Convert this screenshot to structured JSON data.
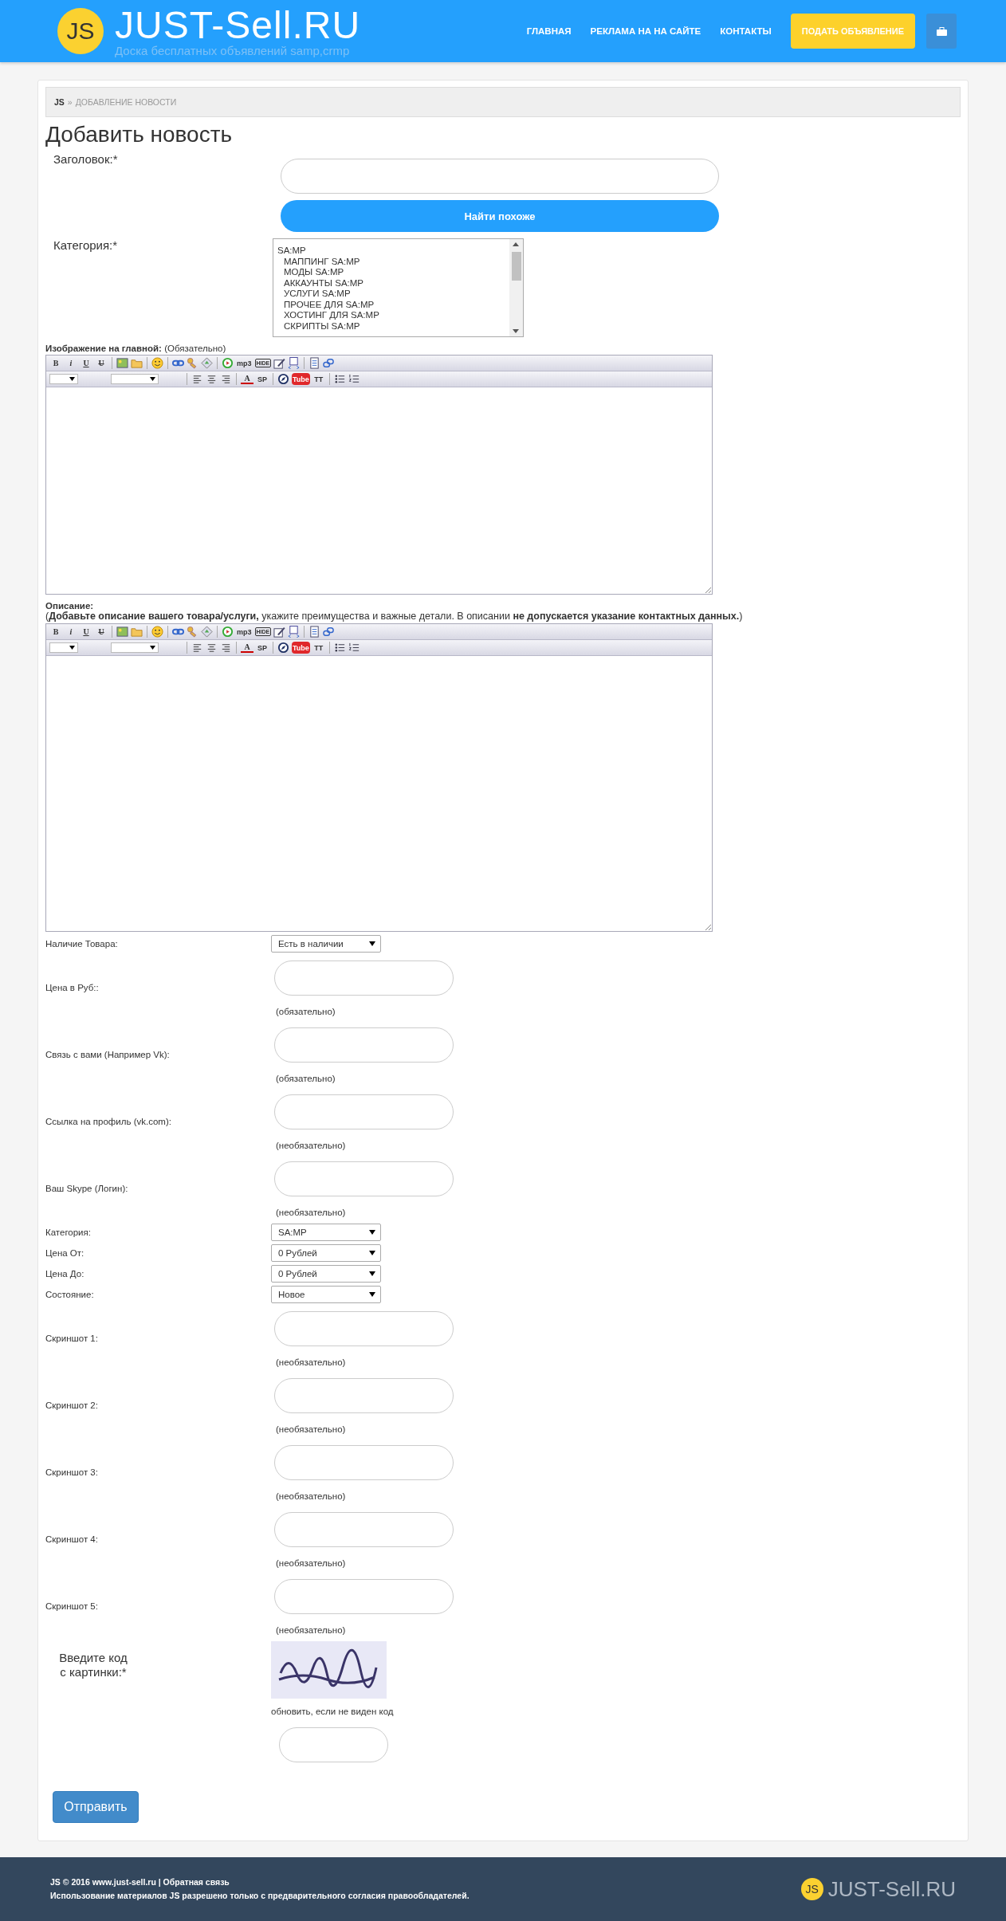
{
  "header": {
    "logo_badge": "JS",
    "brand": "JUST-Sell.RU",
    "tagline": "Доска бесплатных объявлений samp,crmp",
    "nav": [
      {
        "label": "ГЛАВНАЯ"
      },
      {
        "label": "РЕКЛАМА НА НА САЙТЕ"
      },
      {
        "label": "КОНТАКТЫ"
      }
    ],
    "cta": "ПОДАТЬ ОБЪЯВЛЕНИЕ"
  },
  "breadcrumb": {
    "home": "JS",
    "separator": "»",
    "current": "ДОБАВЛЕНИЕ НОВОСТИ"
  },
  "title": "Добавить новость",
  "headline_field": {
    "label": "Заголовок:*",
    "button": "Найти похоже"
  },
  "category_field": {
    "label": "Категория:*",
    "options": [
      {
        "label": "SA:MP",
        "children": [
          {
            "label": "МАППИНГ SA:MP"
          },
          {
            "label": "МОДЫ SA:MP"
          },
          {
            "label": "АККАУНТЫ SA:MP"
          },
          {
            "label": "УСЛУГИ SA:MP"
          },
          {
            "label": "ПРОЧЕЕ ДЛЯ SA:MP"
          },
          {
            "label": "ХОСТИНГ ДЛЯ SA:MP"
          },
          {
            "label": "СКРИПТЫ SA:MP"
          }
        ]
      }
    ]
  },
  "editors": [
    {
      "label": "**Изображение на главной:** (Обязательно)",
      "toolbar": [
        [
          {
            "kind": "bold",
            "label": "B"
          },
          {
            "kind": "italic",
            "label": "i"
          },
          {
            "kind": "underline",
            "label": "U"
          },
          {
            "kind": "strike",
            "label": "U"
          },
          {
            "kind": "sep"
          },
          {
            "kind": "image"
          },
          {
            "kind": "folder"
          },
          {
            "kind": "sep"
          },
          {
            "kind": "smiley"
          },
          {
            "kind": "sep"
          },
          {
            "kind": "link"
          },
          {
            "kind": "key"
          },
          {
            "kind": "paste"
          },
          {
            "kind": "sep"
          },
          {
            "kind": "play"
          },
          {
            "kind": "word",
            "label": "mp3"
          },
          {
            "kind": "tag",
            "label": "HIDE"
          },
          {
            "kind": "edit"
          },
          {
            "kind": "code"
          },
          {
            "kind": "sep"
          },
          {
            "kind": "page"
          },
          {
            "kind": "chain"
          }
        ],
        [
          {
            "kind": "select"
          },
          {
            "kind": "select"
          },
          {
            "kind": "sep"
          },
          {
            "kind": "align-left"
          },
          {
            "kind": "align-center"
          },
          {
            "kind": "align-right"
          },
          {
            "kind": "sep"
          },
          {
            "kind": "color",
            "label": "A"
          },
          {
            "kind": "word",
            "label": "SP"
          },
          {
            "kind": "sep"
          },
          {
            "kind": "compass"
          },
          {
            "kind": "video",
            "label": "Tube"
          },
          {
            "kind": "word",
            "label": "TT"
          },
          {
            "kind": "sep"
          },
          {
            "kind": "bullets"
          },
          {
            "kind": "numbers"
          }
        ]
      ]
    },
    {
      "label": "**Описание:**",
      "note": "(**Добавьте описание вашего товара/услуги,** укажите преимущества и важные детали. В описании **не допускается указание контактных данных.**)",
      "toolbar": [
        [
          {
            "kind": "bold",
            "label": "B"
          },
          {
            "kind": "italic",
            "label": "i"
          },
          {
            "kind": "underline",
            "label": "U"
          },
          {
            "kind": "strike",
            "label": "U"
          },
          {
            "kind": "sep"
          },
          {
            "kind": "image"
          },
          {
            "kind": "folder"
          },
          {
            "kind": "sep"
          },
          {
            "kind": "smiley"
          },
          {
            "kind": "sep"
          },
          {
            "kind": "link"
          },
          {
            "kind": "key"
          },
          {
            "kind": "paste"
          },
          {
            "kind": "sep"
          },
          {
            "kind": "play"
          },
          {
            "kind": "word",
            "label": "mp3"
          },
          {
            "kind": "tag",
            "label": "HIDE"
          },
          {
            "kind": "edit"
          },
          {
            "kind": "code"
          },
          {
            "kind": "sep"
          },
          {
            "kind": "page"
          },
          {
            "kind": "chain"
          }
        ],
        [
          {
            "kind": "select"
          },
          {
            "kind": "select"
          },
          {
            "kind": "sep"
          },
          {
            "kind": "align-left"
          },
          {
            "kind": "align-center"
          },
          {
            "kind": "align-right"
          },
          {
            "kind": "sep"
          },
          {
            "kind": "color",
            "label": "A"
          },
          {
            "kind": "word",
            "label": "SP"
          },
          {
            "kind": "sep"
          },
          {
            "kind": "compass"
          },
          {
            "kind": "video",
            "label": "Tube"
          },
          {
            "kind": "word",
            "label": "TT"
          },
          {
            "kind": "sep"
          },
          {
            "kind": "bullets"
          },
          {
            "kind": "numbers"
          }
        ]
      ]
    }
  ],
  "fields": [
    {
      "kind": "select",
      "label": "Наличие Товара:",
      "value": "Есть в наличии"
    },
    {
      "kind": "input",
      "label": "Цена в Руб::",
      "note": "(обязательно)"
    },
    {
      "kind": "input",
      "label": "Связь с вами (Например Vk):",
      "note": "(обязательно)"
    },
    {
      "kind": "input",
      "label": "Ссылка на профиль (vk.com):",
      "note": "(необязательно)"
    },
    {
      "kind": "input",
      "label": "Ваш Skype (Логин):",
      "note": "(необязательно)"
    },
    {
      "kind": "select",
      "label": "Категория:",
      "value": "SA:MP"
    },
    {
      "kind": "select",
      "label": "Цена От:",
      "value": "0 Рублей"
    },
    {
      "kind": "select",
      "label": "Цена До:",
      "value": "0 Рублей"
    },
    {
      "kind": "select",
      "label": "Состояние:",
      "value": "Новое"
    },
    {
      "kind": "input",
      "label": "Скриншот 1:",
      "note": "(необязательно)"
    },
    {
      "kind": "input",
      "label": "Скриншот 2:",
      "note": "(необязательно)"
    },
    {
      "kind": "input",
      "label": "Скриншот 3:",
      "note": "(необязательно)"
    },
    {
      "kind": "input",
      "label": "Скриншот 4:",
      "note": "(необязательно)"
    },
    {
      "kind": "input",
      "label": "Скриншот 5:",
      "note": "(необязательно)"
    }
  ],
  "captcha": {
    "label_lines": [
      "Введите код",
      "с картинки:*"
    ],
    "refresh": "обновить, если не виден код"
  },
  "submit": "Отправить",
  "footer": {
    "line1": "JS © 2016 www.just-sell.ru | Обратная связь",
    "line2": "Использование материалов JS разрешено только с предварительного согласия правообладателей.",
    "logo_badge": "JS",
    "brand": "JUST-Sell.RU"
  }
}
